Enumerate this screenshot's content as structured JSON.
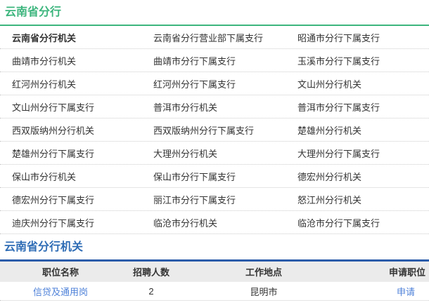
{
  "colors": {
    "green_accent": "#3cb57d",
    "blue_heading": "#2e6cb5",
    "blue_bar": "#2a5caa",
    "link_blue": "#4f82d9",
    "table_header_bg": "#ebebeb",
    "body_text": "#333333"
  },
  "branchSection": {
    "title": "云南省分行",
    "rows": [
      [
        "云南省分行机关",
        "云南省分行营业部下属支行",
        "昭通市分行下属支行"
      ],
      [
        "曲靖市分行机关",
        "曲靖市分行下属支行",
        "玉溪市分行下属支行"
      ],
      [
        "红河州分行机关",
        "红河州分行下属支行",
        "文山州分行机关"
      ],
      [
        "文山州分行下属支行",
        "普洱市分行机关",
        "普洱市分行下属支行"
      ],
      [
        "西双版纳州分行机关",
        "西双版纳州分行下属支行",
        "楚雄州分行机关"
      ],
      [
        "楚雄州分行下属支行",
        "大理州分行机关",
        "大理州分行下属支行"
      ],
      [
        "保山市分行机关",
        "保山市分行下属支行",
        "德宏州分行机关"
      ],
      [
        "德宏州分行下属支行",
        "丽江市分行下属支行",
        "怒江州分行机关"
      ],
      [
        "迪庆州分行下属支行",
        "临沧市分行机关",
        "临沧市分行下属支行"
      ]
    ]
  },
  "orgSection": {
    "title": "云南省分行机关",
    "table": {
      "headers": [
        "职位名称",
        "招聘人数",
        "工作地点",
        "申请职位"
      ],
      "row": {
        "position": "信贷及通用岗",
        "count": "2",
        "location": "昆明市",
        "apply_label": "申请"
      }
    }
  }
}
